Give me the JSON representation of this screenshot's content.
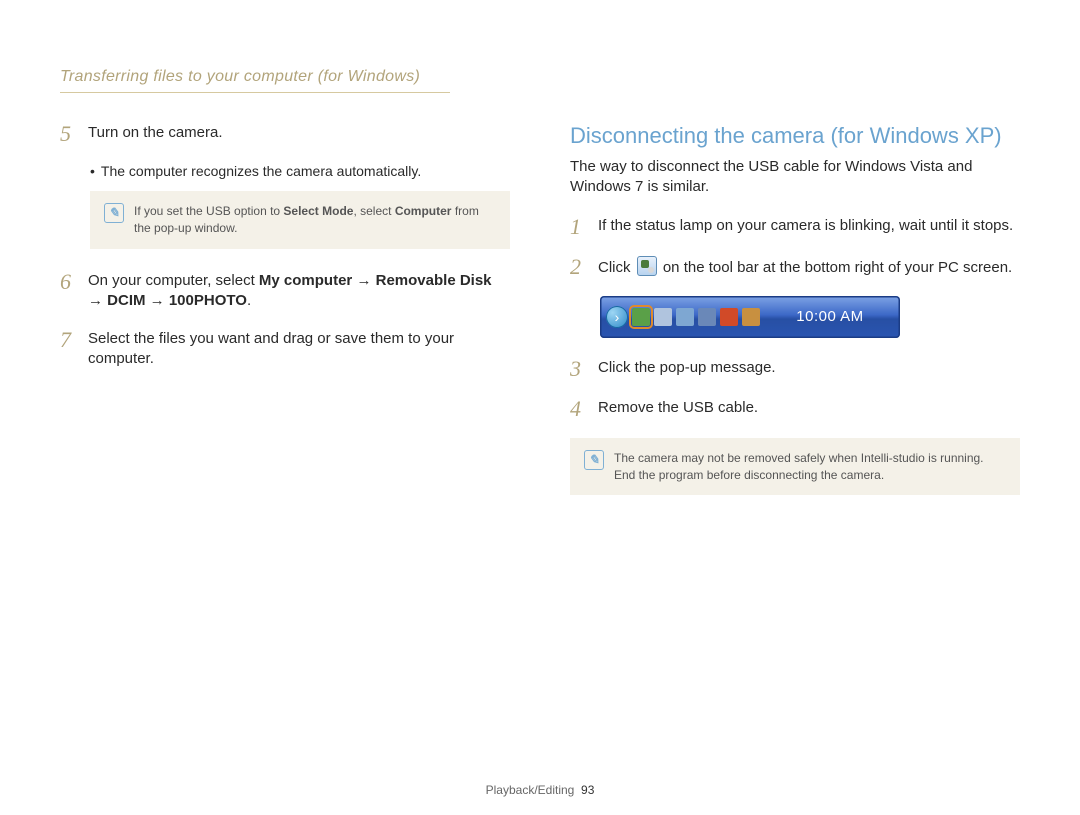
{
  "header": "Transferring files to your computer (for Windows)",
  "left": {
    "steps": {
      "s5": {
        "num": "5",
        "text_plain": "Turn on the camera."
      },
      "s5_bullet": "The computer recognizes the camera automatically.",
      "note5_pre": "If you set the USB option to ",
      "note5_b1": "Select Mode",
      "note5_mid": ", select ",
      "note5_b2": "Computer",
      "note5_post": " from the pop-up window.",
      "s6": {
        "num": "6",
        "t1": "On your computer, select ",
        "b1": "My computer",
        "arrow": " → ",
        "b2": "Removable Disk",
        "b3": "DCIM",
        "b4": "100PHOTO",
        "dot": "."
      },
      "s7": {
        "num": "7",
        "text": "Select the files you want and drag or save them to your computer."
      }
    }
  },
  "right": {
    "title": "Disconnecting the camera (for Windows XP)",
    "intro": "The way to disconnect the USB cable for Windows Vista and Windows 7 is similar.",
    "steps": {
      "s1": {
        "num": "1",
        "text": "If the status lamp on your camera is blinking, wait until it stops."
      },
      "s2": {
        "num": "2",
        "pre": "Click ",
        "post": " on the tool bar at the bottom right of your PC screen."
      },
      "s3": {
        "num": "3",
        "text": "Click the pop-up message."
      },
      "s4": {
        "num": "4",
        "text": "Remove the USB cable."
      }
    },
    "taskbar_time": "10:00 AM",
    "end_note": "The camera may not be removed safely when Intelli-studio is running. End the program before disconnecting the camera."
  },
  "footer": {
    "section": "Playback/Editing",
    "page": "93"
  }
}
